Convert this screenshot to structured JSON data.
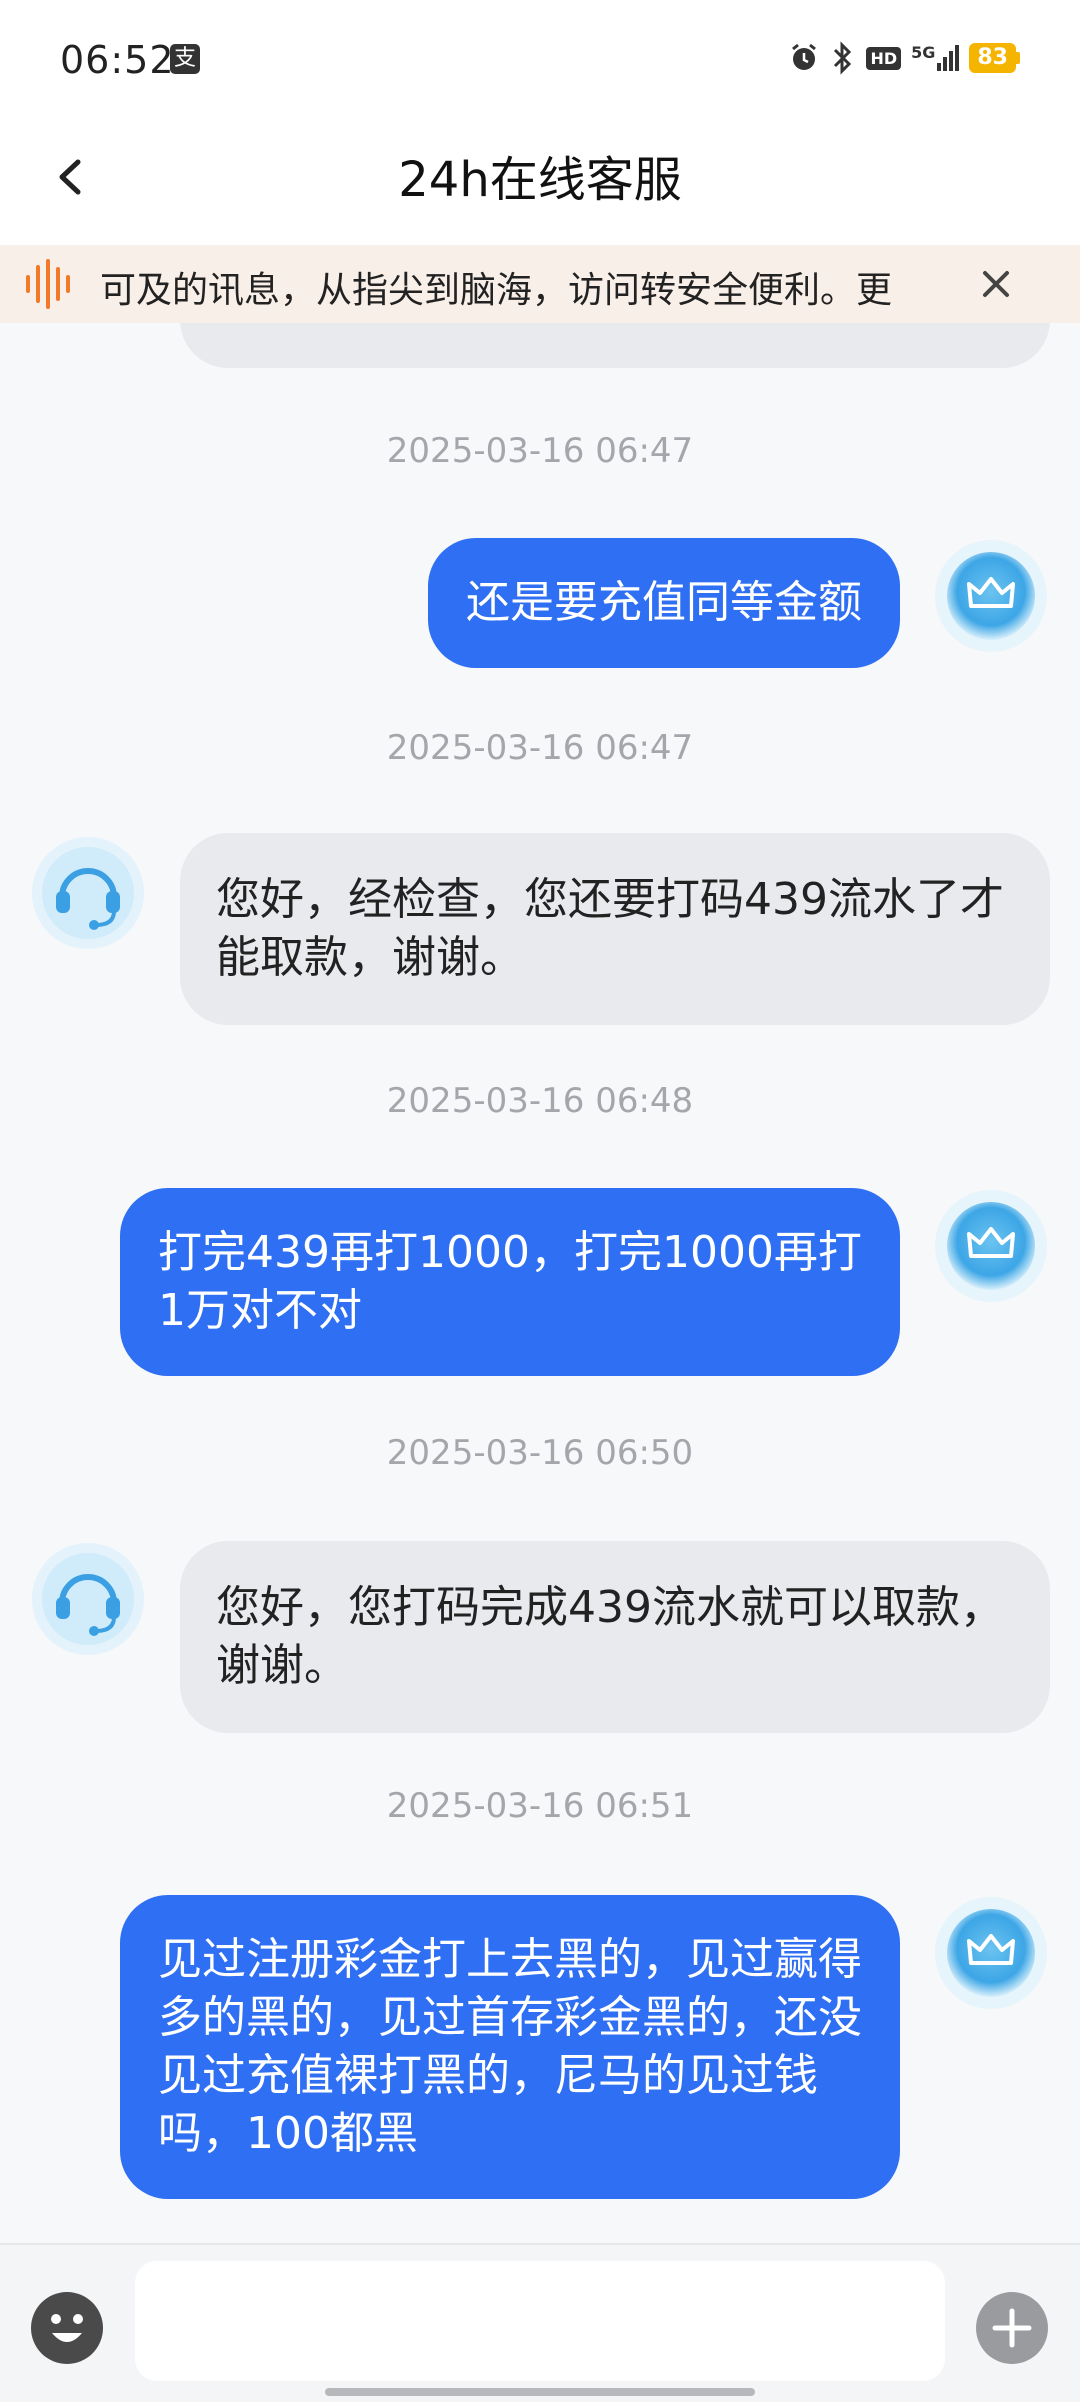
{
  "status_bar": {
    "time": "06:52",
    "app_icon_char": "支",
    "network": "5G",
    "hd": "HD",
    "battery": "83"
  },
  "header": {
    "title": "24h在线客服"
  },
  "notice": {
    "text": "可及的讯息，从指尖到脑海，访问转安全便利。更"
  },
  "messages": [
    {
      "type": "agent_partial",
      "text": ""
    },
    {
      "type": "timestamp",
      "text": "2025-03-16 06:47"
    },
    {
      "type": "user",
      "text": "还是要充值同等金额"
    },
    {
      "type": "timestamp",
      "text": "2025-03-16 06:47"
    },
    {
      "type": "agent",
      "text": "您好，经检查，您还要打码439流水了才能取款，谢谢。"
    },
    {
      "type": "timestamp",
      "text": "2025-03-16 06:48"
    },
    {
      "type": "user",
      "text": "打完439再打1000，打完1000再打1万对不对"
    },
    {
      "type": "timestamp",
      "text": "2025-03-16 06:50"
    },
    {
      "type": "agent",
      "text": "您好，您打码完成439流水就可以取款，谢谢。"
    },
    {
      "type": "timestamp",
      "text": "2025-03-16 06:51"
    },
    {
      "type": "user",
      "text": "见过注册彩金打上去黑的，见过赢得多的黑的，见过首存彩金黑的，还没见过充值裸打黑的，尼马的见过钱吗，100都黑"
    }
  ],
  "input": {
    "value": "",
    "placeholder": ""
  },
  "colors": {
    "user_bubble": "#2f6ff3",
    "agent_bubble": "#e9eaee",
    "battery": "#f5b400",
    "accent_notice": "#f07a2a"
  },
  "icons": {
    "back": "chevron-left-icon",
    "notice": "sound-wave-icon",
    "close": "close-icon",
    "agent_avatar": "headset-icon",
    "user_avatar": "crown-icon",
    "emoji": "emoji-icon",
    "plus": "plus-icon"
  }
}
